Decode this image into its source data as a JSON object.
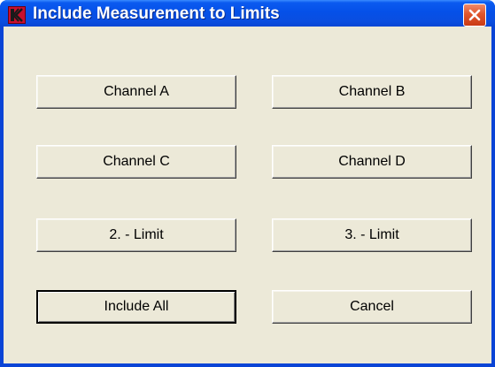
{
  "window": {
    "title": "Include Measurement to Limits",
    "icons": {
      "app": "app-logo-icon",
      "close": "close-icon"
    },
    "colors": {
      "titlebar": "#0550e8",
      "client": "#ece9d8",
      "close": "#e0562c"
    }
  },
  "buttons": {
    "channel_a": "Channel A",
    "channel_b": "Channel B",
    "channel_c": "Channel C",
    "channel_d": "Channel D",
    "limit_2": "2. - Limit",
    "limit_3": "3. - Limit",
    "include_all": "Include All",
    "cancel": "Cancel"
  }
}
